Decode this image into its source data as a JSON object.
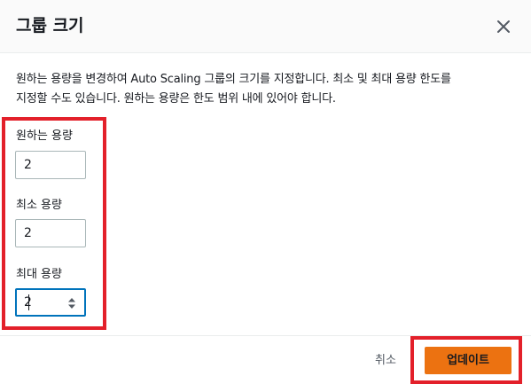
{
  "dialog": {
    "title": "그룹 크기",
    "close_icon": "close-icon",
    "description_line1": "원하는 용량을 변경하여 Auto Scaling 그룹의 크기를 지정합니다. 최소 및 최대 용량 한도를",
    "description_line2": "지정할 수도 있습니다. 원하는 용량은 한도 범위 내에 있어야 합니다."
  },
  "fields": {
    "desired": {
      "label": "원하는 용량",
      "value": "2"
    },
    "minimum": {
      "label": "최소 용량",
      "value": "2"
    },
    "maximum": {
      "label": "최대 용량",
      "value": "2"
    }
  },
  "footer": {
    "cancel_label": "취소",
    "update_label": "업데이트"
  },
  "colors": {
    "primary_button": "#ec7211",
    "focus_border": "#0073bb",
    "highlight_annotation": "#e3202a"
  }
}
